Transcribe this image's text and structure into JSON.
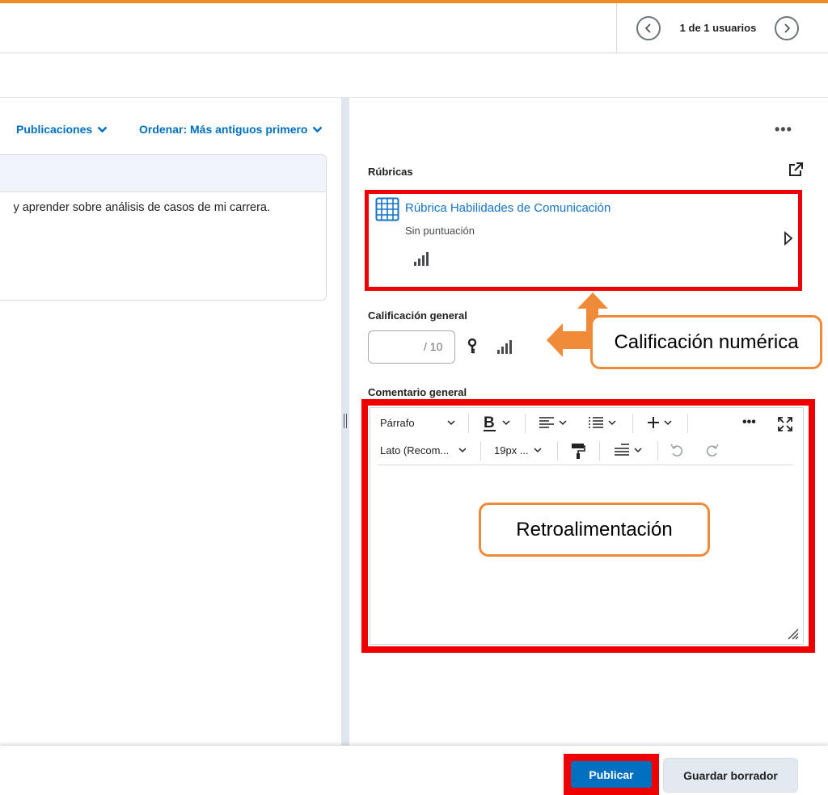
{
  "header": {
    "user_count": "1 de 1 usuarios"
  },
  "left": {
    "filter_publications": "Publicaciones",
    "filter_sort": "Ordenar: Más antiguos primero",
    "post_text": "y aprender sobre análisis de casos de mi carrera."
  },
  "right": {
    "rubrics_label": "Rúbricas",
    "rubric_title": "Rúbrica Habilidades de Comunicación",
    "rubric_score": "Sin puntuación",
    "overall_grade_label": "Calificación general",
    "grade_value": "",
    "grade_suffix": "/ 10",
    "overall_comment_label": "Comentario general"
  },
  "editor": {
    "format_block": "Párrafo",
    "font_family": "Lato (Recom...",
    "font_size": "19px ..."
  },
  "annotations": {
    "numeric_grade": "Calificación numérica",
    "feedback": "Retroalimentación"
  },
  "footer": {
    "publish_label": "Publicar",
    "save_draft_label": "Guardar borrador"
  },
  "colors": {
    "accent": "#f08a24",
    "link": "#006fbf",
    "highlight": "#ee0000",
    "callout_border": "#ef8a39"
  },
  "icons": [
    "chevron-left-icon",
    "chevron-right-icon",
    "chevron-down-icon",
    "more-icon",
    "popout-icon",
    "rubric-grid-icon",
    "signal-icon",
    "expand-icon",
    "key-icon",
    "bold-icon",
    "align-icon",
    "list-icon",
    "plus-icon",
    "fullscreen-icon",
    "format-painter-icon",
    "line-spacing-icon",
    "undo-icon",
    "redo-icon",
    "resize-icon"
  ]
}
